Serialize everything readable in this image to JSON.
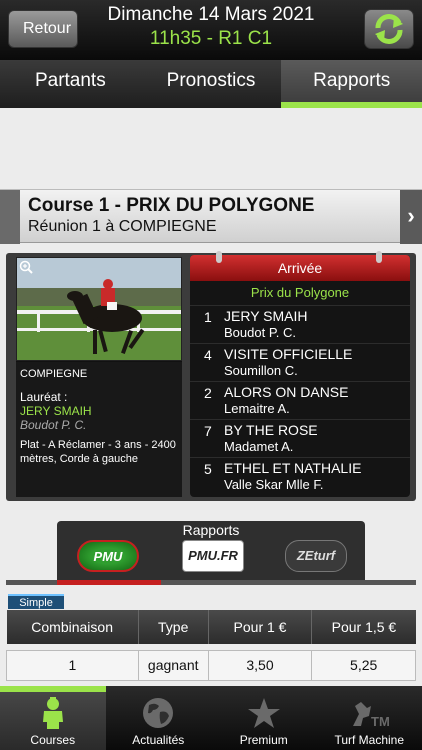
{
  "header": {
    "back_label": "Retour",
    "date": "Dimanche 14 Mars 2021",
    "time_race": "11h35 - R1 C1"
  },
  "tabs": [
    {
      "label": "Partants",
      "active": false
    },
    {
      "label": "Pronostics",
      "active": false
    },
    {
      "label": "Rapports",
      "active": true
    }
  ],
  "course": {
    "title": "Course 1 - PRIX DU POLYGONE",
    "subtitle": "Réunion 1 à COMPIEGNE"
  },
  "race_info": {
    "venue": "COMPIEGNE",
    "laureat_label": "Lauréat :",
    "laureat_horse": "JERY SMAIH",
    "laureat_jockey": "Boudot P. C.",
    "description": "Plat - A Réclamer - 3 ans - 2400 mètres, Corde à gauche"
  },
  "arrivee": {
    "header": "Arrivée",
    "race_name": "Prix du Polygone",
    "results": [
      {
        "num": "1",
        "horse": "JERY SMAIH",
        "jockey": "Boudot P. C."
      },
      {
        "num": "4",
        "horse": "VISITE OFFICIELLE",
        "jockey": "Soumillon C."
      },
      {
        "num": "2",
        "horse": "ALORS ON DANSE",
        "jockey": "Lemaitre A."
      },
      {
        "num": "7",
        "horse": "BY THE ROSE",
        "jockey": "Madamet A."
      },
      {
        "num": "5",
        "horse": "ETHEL ET NATHALIE",
        "jockey": "Valle Skar Mlle F."
      }
    ]
  },
  "rapports": {
    "title": "Rapports",
    "providers": [
      {
        "label": "PMU",
        "active": true
      },
      {
        "label": "PMU.FR",
        "active": false
      },
      {
        "label": "ZEturf",
        "active": false
      }
    ],
    "simple_tag": "Simple",
    "columns": [
      "Combinaison",
      "Type",
      "Pour 1 €",
      "Pour 1,5 €"
    ],
    "rows": [
      [
        "1",
        "gagnant",
        "3,50",
        "5,25"
      ]
    ]
  },
  "bottom_nav": [
    {
      "label": "Courses",
      "icon": "jockey-icon",
      "active": true
    },
    {
      "label": "Actualités",
      "icon": "globe-icon",
      "active": false
    },
    {
      "label": "Premium",
      "icon": "star-icon",
      "active": false
    },
    {
      "label": "Turf Machine",
      "icon": "turf-machine-icon",
      "active": false
    }
  ],
  "colors": {
    "accent_green": "#9be34a",
    "arrivee_red": "#c52020",
    "dark": "#1e1e1e"
  }
}
